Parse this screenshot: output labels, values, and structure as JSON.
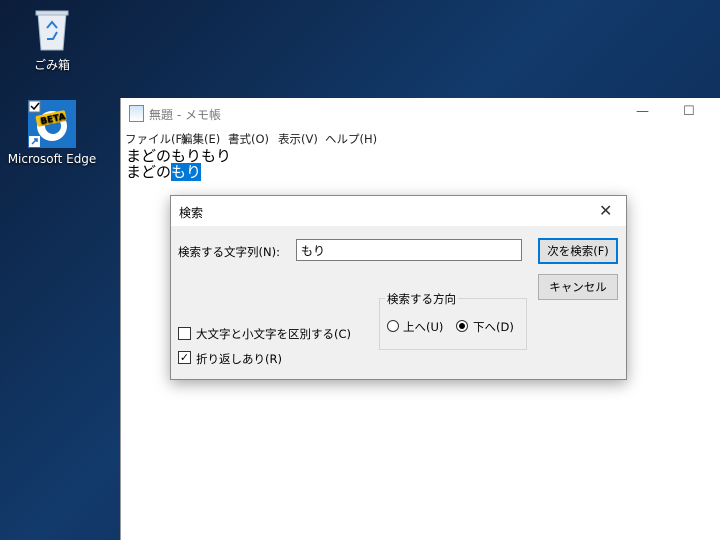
{
  "desktop": {
    "icons": [
      {
        "label": "ごみ箱",
        "icon": "recycle-bin-icon"
      },
      {
        "label": "Microsoft Edge",
        "icon": "edge-beta-icon",
        "badge": "BETA"
      }
    ]
  },
  "notepad": {
    "title": "無題 - メモ帳",
    "menu": [
      "ファイル(F)",
      "編集(E)",
      "書式(O)",
      "表示(V)",
      "ヘルプ(H)"
    ],
    "line1": "まどのもりもり",
    "line2_prefix": "まどの",
    "line2_selected": "もり"
  },
  "find_dialog": {
    "title": "検索",
    "find_label": "検索する文字列(N):",
    "find_value": "もり",
    "find_next_label": "次を検索(F)",
    "cancel_label": "キャンセル",
    "direction_label": "検索する方向",
    "up_label": "上へ(U)",
    "down_label": "下へ(D)",
    "direction_selected": "down",
    "match_case_label": "大文字と小文字を区別する(C)",
    "match_case_checked": false,
    "wrap_label": "折り返しあり(R)",
    "wrap_checked": true
  },
  "colors": {
    "selection": "#0078d7",
    "desktop": "#123a6b"
  }
}
